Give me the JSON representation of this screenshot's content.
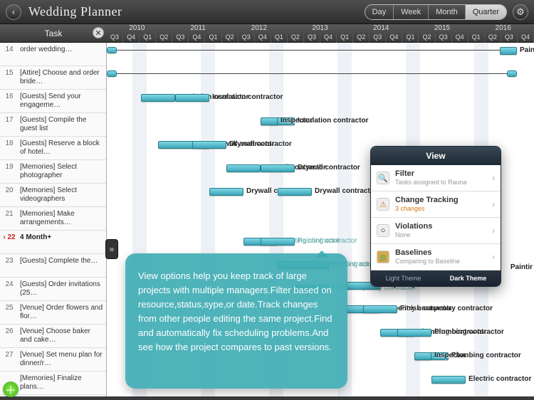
{
  "app": {
    "title": "Wedding Planner",
    "range_tabs": [
      "Day",
      "Week",
      "Month",
      "Quarter"
    ],
    "range_selected": "Quarter"
  },
  "columns": {
    "task_header": "Task"
  },
  "timeline": {
    "years": [
      "2010",
      "2011",
      "2012",
      "2013",
      "2014",
      "2015",
      "2016"
    ],
    "quarters_pattern": [
      "Q3",
      "Q4",
      "Q1",
      "Q2"
    ]
  },
  "tasks": [
    {
      "num": "14",
      "name": "order wedding…"
    },
    {
      "num": "15",
      "name": "[Attire] Choose and order bride…"
    },
    {
      "num": "16",
      "name": "[Guests] Send your engageme…"
    },
    {
      "num": "17",
      "name": "[Guests] Compile the guest list"
    },
    {
      "num": "18",
      "name": "[Guests] Reserve a block of hotel…"
    },
    {
      "num": "19",
      "name": "[Memories] Select photographer"
    },
    {
      "num": "20",
      "name": "[Memories] Select videographers"
    },
    {
      "num": "21",
      "name": "[Memories] Make arrangements…"
    },
    {
      "num": "22",
      "name": "4 Month+",
      "hl": true
    },
    {
      "num": "23",
      "name": "[Guests] Complete the…"
    },
    {
      "num": "24",
      "name": "[Guests] Order invitations (25…"
    },
    {
      "num": "25",
      "name": "[Venue] Order flowers and flor…"
    },
    {
      "num": "26",
      "name": "[Venue] Choose baker and cake…"
    },
    {
      "num": "27",
      "name": "[Venue] Set menu plan for dinner/r…"
    },
    {
      "num": "",
      "name": "[Memories] Finalize plans…"
    }
  ],
  "gantt_labels": {
    "insulation": "Insulation contractor",
    "inspector": "Inspector",
    "drywall": "Drywall contractor",
    "painting": "Painting contractor",
    "finish_carpentry": "Finish carpentry contractor",
    "carpentry": "carpentry contractor",
    "plumbing": "Plumbing contractor",
    "electric": "Electric contractor",
    "paintir": "Paintir"
  },
  "view_popover": {
    "title": "View",
    "items": [
      {
        "key": "filter",
        "title": "Filter",
        "sub": "Tasks assigned to Rauna",
        "sub_class": "gray",
        "icon": "🔍"
      },
      {
        "key": "change_tracking",
        "title": "Change Tracking",
        "sub": "3 changes",
        "sub_class": "orange",
        "icon": "⚠"
      },
      {
        "key": "violations",
        "title": "Violations",
        "sub": "None",
        "sub_class": "gray",
        "icon": "○"
      },
      {
        "key": "baselines",
        "title": "Baselines",
        "sub": "Comparing to Baseline",
        "sub_class": "gray",
        "icon": "▦"
      }
    ],
    "theme_light": "Light Theme",
    "theme_dark": "Dark Theme",
    "theme_selected": "Dark Theme"
  },
  "callout_text": "View options help you keep track of large projects with multiple managers.Filter based on resource,status,sype,or date.Track changes from other people editing the same project.Find and automatically fix scheduling problems.And see how the project compares to past versions.",
  "chart_data": {
    "type": "gantt",
    "time_axis": {
      "start": "2010-Q3",
      "end": "2016-Q3",
      "unit": "quarter"
    },
    "notes": "Positions read approximately from pixel grid; quarter ticks every ~22px.",
    "bars": [
      {
        "row": 14,
        "label": "",
        "start": "2010-Q3",
        "end": "2016-Q3",
        "style": "thin-summary"
      },
      {
        "row": 15,
        "label": "",
        "start": "2010-Q3",
        "end": "2016-Q3",
        "style": "thin-summary"
      },
      {
        "row": 16,
        "label": "Insulation contractor",
        "start": "2011-Q1",
        "end": "2011-Q3"
      },
      {
        "row": 16,
        "label": "Insulation contractor",
        "start": "2011-Q3",
        "end": "2012-Q1"
      },
      {
        "row": 17,
        "label": "Insulation contractor",
        "start": "2012-Q4",
        "end": "2013-Q2"
      },
      {
        "row": 17,
        "label": "Inspector",
        "start": "2012-Q4",
        "end": "2013-Q1"
      },
      {
        "row": 18,
        "label": "Drywall contractor",
        "start": "2011-Q2",
        "end": "2012-Q1"
      },
      {
        "row": 18,
        "label": "Drywall contractor",
        "start": "2011-Q4",
        "end": "2012-Q2"
      },
      {
        "row": 19,
        "label": "Drywall contractor",
        "start": "2012-Q2",
        "end": "2012-Q4"
      },
      {
        "row": 19,
        "label": "Drywall contractor",
        "start": "2012-Q4",
        "end": "2013-Q2"
      },
      {
        "row": 20,
        "label": "Drywall contractor",
        "start": "2012-Q1",
        "end": "2012-Q3"
      },
      {
        "row": 20,
        "label": "Drywall contractor",
        "start": "2013-Q1",
        "end": "2013-Q3"
      },
      {
        "row": 22,
        "label": "Painting contractor",
        "start": "2012-Q3",
        "end": "2013-Q1",
        "dim": true
      },
      {
        "row": 22,
        "label": "Painting contractor",
        "start": "2012-Q4",
        "end": "2013-Q2",
        "dim": true
      },
      {
        "row": 23,
        "label": "Painting contractor",
        "start": "2013-Q1",
        "end": "2013-Q3",
        "dim": true
      },
      {
        "row": 23,
        "label": "Painting contractor",
        "start": "2013-Q2",
        "end": "2013-Q4",
        "dim": true
      },
      {
        "row": 24,
        "label": "Finish carpentry contractor",
        "start": "2013-Q2",
        "end": "2013-Q4",
        "dim": true
      },
      {
        "row": 24,
        "label": "carpentry contractor",
        "start": "2014-Q1",
        "end": "2014-Q3"
      },
      {
        "row": 25,
        "label": "carpentry contractor",
        "start": "2014-Q1",
        "end": "2014-Q3"
      },
      {
        "row": 25,
        "label": "Finish carpentry contractor",
        "start": "2014-Q2",
        "end": "2014-Q4"
      },
      {
        "row": 26,
        "label": "Plumbing contractor",
        "start": "2014-Q3",
        "end": "2015-Q1"
      },
      {
        "row": 26,
        "label": "Plumbing contractor",
        "start": "2014-Q4",
        "end": "2015-Q2"
      },
      {
        "row": 27,
        "label": "Plumbing contractor",
        "start": "2015-Q1",
        "end": "2015-Q3"
      },
      {
        "row": 27,
        "label": "Inspector",
        "start": "2015-Q1",
        "end": "2015-Q2"
      },
      {
        "row": 28,
        "label": "Electric contractor",
        "start": "2015-Q2",
        "end": "2015-Q4"
      },
      {
        "row": 14,
        "label": "Paintir",
        "start": "2016-Q2",
        "end": "2016-Q3",
        "edge": "right"
      }
    ]
  }
}
